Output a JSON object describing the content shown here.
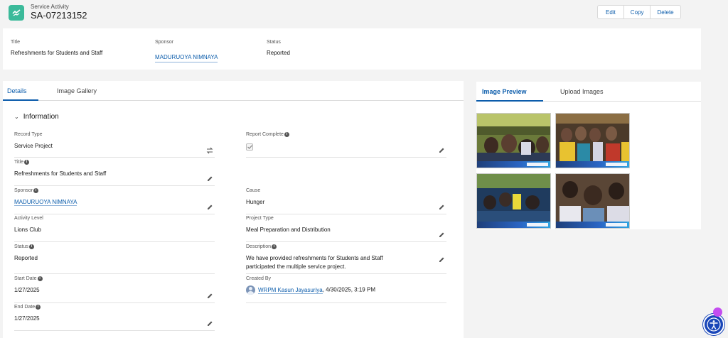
{
  "header": {
    "object_type": "Service Activity",
    "record_name": "SA-07213152",
    "buttons": {
      "edit": "Edit",
      "copy": "Copy",
      "delete": "Delete"
    }
  },
  "highlights": {
    "title_label": "Title",
    "title_value": "Refreshments for Students and Staff",
    "sponsor_label": "Sponsor",
    "sponsor_value": "MADURUOYA NIMNAYA",
    "status_label": "Status",
    "status_value": "Reported"
  },
  "main_tabs": {
    "details": "Details",
    "gallery": "Image Gallery"
  },
  "section": {
    "title": "Information"
  },
  "fields": {
    "record_type": {
      "label": "Record Type",
      "value": "Service Project"
    },
    "report_complete": {
      "label": "Report Complete"
    },
    "title": {
      "label": "Title",
      "value": "Refreshments for Students and Staff"
    },
    "sponsor": {
      "label": "Sponsor",
      "value": "MADURUOYA NIMNAYA"
    },
    "cause": {
      "label": "Cause",
      "value": "Hunger"
    },
    "activity_level": {
      "label": "Activity Level",
      "value": "Lions Club"
    },
    "project_type": {
      "label": "Project Type",
      "value": "Meal Preparation and Distribution"
    },
    "status": {
      "label": "Status",
      "value": "Reported"
    },
    "description": {
      "label": "Description",
      "line1": "We have provided refreshments for Students and Staff",
      "line2": "participated the multiple service project."
    },
    "start_date": {
      "label": "Start Date",
      "value": "1/27/2025"
    },
    "created_by": {
      "label": "Created By",
      "user": "WRPM Kasun Jayasuriya",
      "date": ", 4/30/2025, 3:19 PM"
    },
    "end_date": {
      "label": "End Date",
      "value": "1/27/2025"
    }
  },
  "side_tabs": {
    "preview": "Image Preview",
    "upload": "Upload Images"
  },
  "colors": {
    "brand": "#0b5cab",
    "object_icon": "#3bba9a",
    "accessibility": "#1946b8"
  }
}
